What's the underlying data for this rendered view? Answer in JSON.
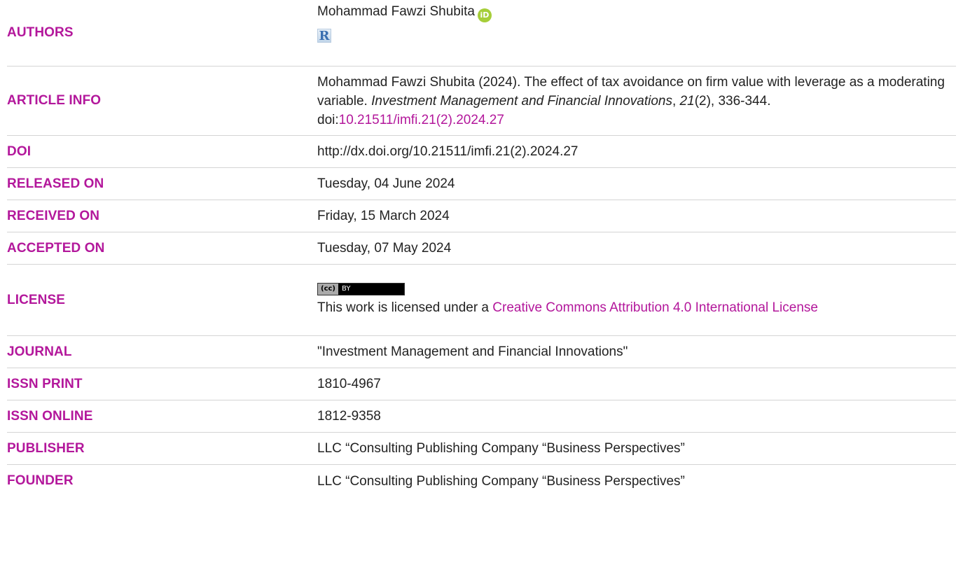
{
  "authors": {
    "label": "AUTHORS",
    "name": "Mohammad Fawzi Shubita",
    "orcid_icon": "orcid-icon",
    "researcherid_icon": "researcherid-icon",
    "orcid_glyph": "iD",
    "researcherid_glyph": "R"
  },
  "article_info": {
    "label": "ARTICLE INFO",
    "citation_prefix": "Mohammad Fawzi Shubita (2024). The effect of tax avoidance on firm value with leverage as a moderating variable. ",
    "journal_italic": "Investment Management and Financial Innovations",
    "sep1": ", ",
    "volume_italic": "21",
    "issue_pages": "(2), 336-344. doi:",
    "doi_link": "10.21511/imfi.21(2).2024.27"
  },
  "doi": {
    "label": "DOI",
    "value": "http://dx.doi.org/10.21511/imfi.21(2).2024.27"
  },
  "released_on": {
    "label": "RELEASED ON",
    "value": "Tuesday, 04 June 2024"
  },
  "received_on": {
    "label": "RECEIVED ON",
    "value": "Friday, 15 March 2024"
  },
  "accepted_on": {
    "label": "ACCEPTED ON",
    "value": "Tuesday, 07 May 2024"
  },
  "license": {
    "label": "LICENSE",
    "badge_left": "(cc)",
    "badge_right": "BY",
    "text_prefix": "This work is licensed under a ",
    "link_text": "Creative Commons Attribution 4.0 International License"
  },
  "journal": {
    "label": "JOURNAL",
    "value": "\"Investment Management and Financial Innovations\""
  },
  "issn_print": {
    "label": "ISSN PRINT",
    "value": "1810-4967"
  },
  "issn_online": {
    "label": "ISSN ONLINE",
    "value": "1812-9358"
  },
  "publisher": {
    "label": "PUBLISHER",
    "value": "LLC “Consulting Publishing Company “Business Perspectives”"
  },
  "founder": {
    "label": "FOUNDER",
    "value": "LLC “Consulting Publishing Company “Business Perspectives”"
  },
  "colors": {
    "accent": "#b3179b",
    "text": "#222222",
    "divider": "#d4d4d4",
    "orcid": "#a6ce39"
  }
}
